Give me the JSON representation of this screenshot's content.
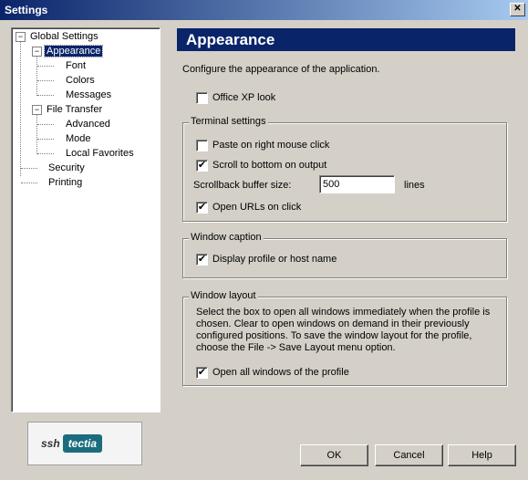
{
  "window": {
    "title": "Settings",
    "close_glyph": "✕"
  },
  "tree": {
    "root_expander": "−",
    "global_settings": "Global Settings",
    "appearance_expander": "−",
    "appearance": "Appearance",
    "font": "Font",
    "colors": "Colors",
    "messages": "Messages",
    "file_transfer_expander": "−",
    "file_transfer": "File Transfer",
    "advanced": "Advanced",
    "mode": "Mode",
    "local_favorites": "Local Favorites",
    "security": "Security",
    "printing": "Printing"
  },
  "logo": {
    "ssh": "ssh",
    "tectia": "tectia"
  },
  "panel": {
    "title": "Appearance",
    "description": "Configure the appearance of the application.",
    "office_xp_look": {
      "label": "Office XP look",
      "checked": false,
      "mark": ""
    },
    "terminal": {
      "title": "Terminal settings",
      "paste": {
        "label": "Paste on right mouse click",
        "checked": false,
        "mark": ""
      },
      "scroll": {
        "label": "Scroll to bottom on output",
        "checked": true,
        "mark": "✔"
      },
      "buffer_label": "Scrollback buffer size:",
      "buffer_value": "500",
      "buffer_unit": "lines",
      "urls": {
        "label": "Open URLs on click",
        "checked": true,
        "mark": "✔"
      }
    },
    "caption": {
      "title": "Window caption",
      "display": {
        "label": "Display profile or host name",
        "checked": true,
        "mark": "✔"
      }
    },
    "layout": {
      "title": "Window layout",
      "description": "Select the box to open all windows immediately when the profile is chosen. Clear to open windows on demand in their previously configured positions. To save the window layout for the profile, choose the File -> Save Layout menu option.",
      "open_all": {
        "label": "Open all windows of the profile",
        "checked": true,
        "mark": "✔"
      }
    }
  },
  "buttons": {
    "ok": "OK",
    "cancel": "Cancel",
    "help": "Help"
  }
}
